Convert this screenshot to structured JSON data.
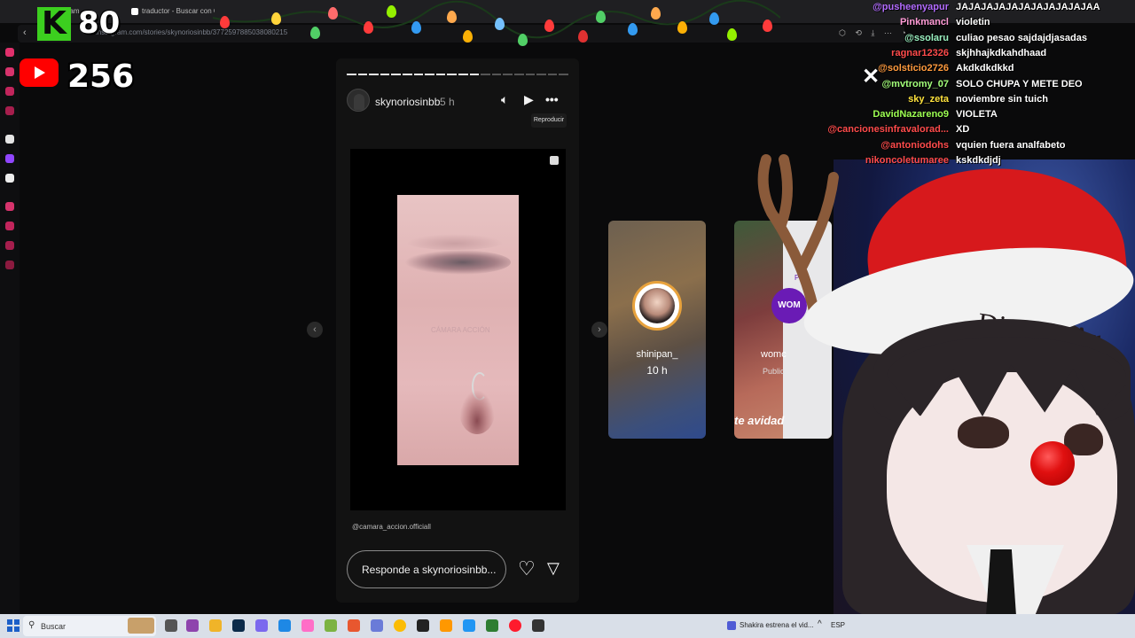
{
  "browser": {
    "tabs": [
      {
        "label": "Instagram"
      },
      {
        "label": "traductor - Buscar con G"
      }
    ],
    "url": "instagram.com/stories/skynoriosinbb/3772597885038080215"
  },
  "overlay": {
    "kick_count": "80",
    "kick_letter": "K",
    "youtube_count": "256"
  },
  "story": {
    "username": "skynoriosinbb",
    "time": "5 h",
    "tooltip": "Reproducir",
    "watermark": "CÁMARA ACCIÓN",
    "mention": "@camara_accion.officiall",
    "reply_placeholder": "Responde a skynoriosinbb...",
    "progress_segments": 20,
    "progress_active": 12
  },
  "next_stories": [
    {
      "name": "shinipan_",
      "time": "10 h"
    },
    {
      "name": "womc",
      "badge": "WOM",
      "sub": "Public",
      "plan": "Plan",
      "caption": "te avidad"
    }
  ],
  "chat": [
    {
      "user": "@pusheenyapur",
      "message": "JAJAJAJAJAJAJAJAJAJAJAA",
      "color": "#b26bff"
    },
    {
      "user": "Pinkmancl",
      "message": "violetin",
      "color": "#ff9ad5"
    },
    {
      "user": "@ssolaru",
      "message": "culiao pesao sajdajdjasadas",
      "color": "#9af0c0"
    },
    {
      "user": "ragnar12326",
      "message": "skjhhajkdkahdhaad",
      "color": "#ff4b4b"
    },
    {
      "user": "@solsticio2726",
      "message": "Akdkdkdkkd",
      "color": "#ff9a3d"
    },
    {
      "user": "@mvtromy_07",
      "message": "SOLO CHUPA Y METE DEO",
      "color": "#a3ff7a"
    },
    {
      "user": "sky_zeta",
      "message": "noviembre sin tuich",
      "color": "#ffe23d"
    },
    {
      "user": "DavidNazareno9",
      "message": "VIOLETA",
      "color": "#9dff52"
    },
    {
      "user": "@cancionesinfravalorad...",
      "message": "XD",
      "color": "#ff4b4b"
    },
    {
      "user": "@antoniodohs",
      "message": "vquien fuera analfabeto",
      "color": "#ff4b4b"
    },
    {
      "user": "nikoncoletumaree",
      "message": "kskdkdjdj",
      "color": "#ff4b4b"
    }
  ],
  "vtuber": {
    "banner_text": "Dios Te Ar"
  },
  "taskbar": {
    "search_placeholder": "Buscar",
    "news": "Shakira estrena el vid...",
    "lang": "ESP"
  }
}
